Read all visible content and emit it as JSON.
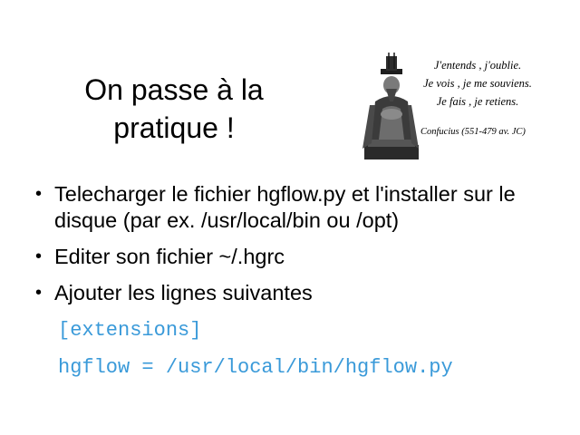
{
  "slide": {
    "title_line1": "On passe à la",
    "title_line2": "pratique !"
  },
  "figure": {
    "image": "confucius-statue",
    "quote_lines": [
      "J'entends , j'oublie.",
      "Je vois , je me souviens.",
      "Je fais , je retiens."
    ],
    "citation": "Confucius (551-479 av. JC)"
  },
  "bullets": [
    "Telecharger le fichier hgflow.py et l'installer sur le disque (par ex. /usr/local/bin ou /opt)",
    "Editer son fichier ~/.hgrc",
    "Ajouter les lignes suivantes"
  ],
  "code": {
    "line1": "[extensions]",
    "line2": "hgflow = /usr/local/bin/hgflow.py",
    "color": "#3a9ad9"
  }
}
